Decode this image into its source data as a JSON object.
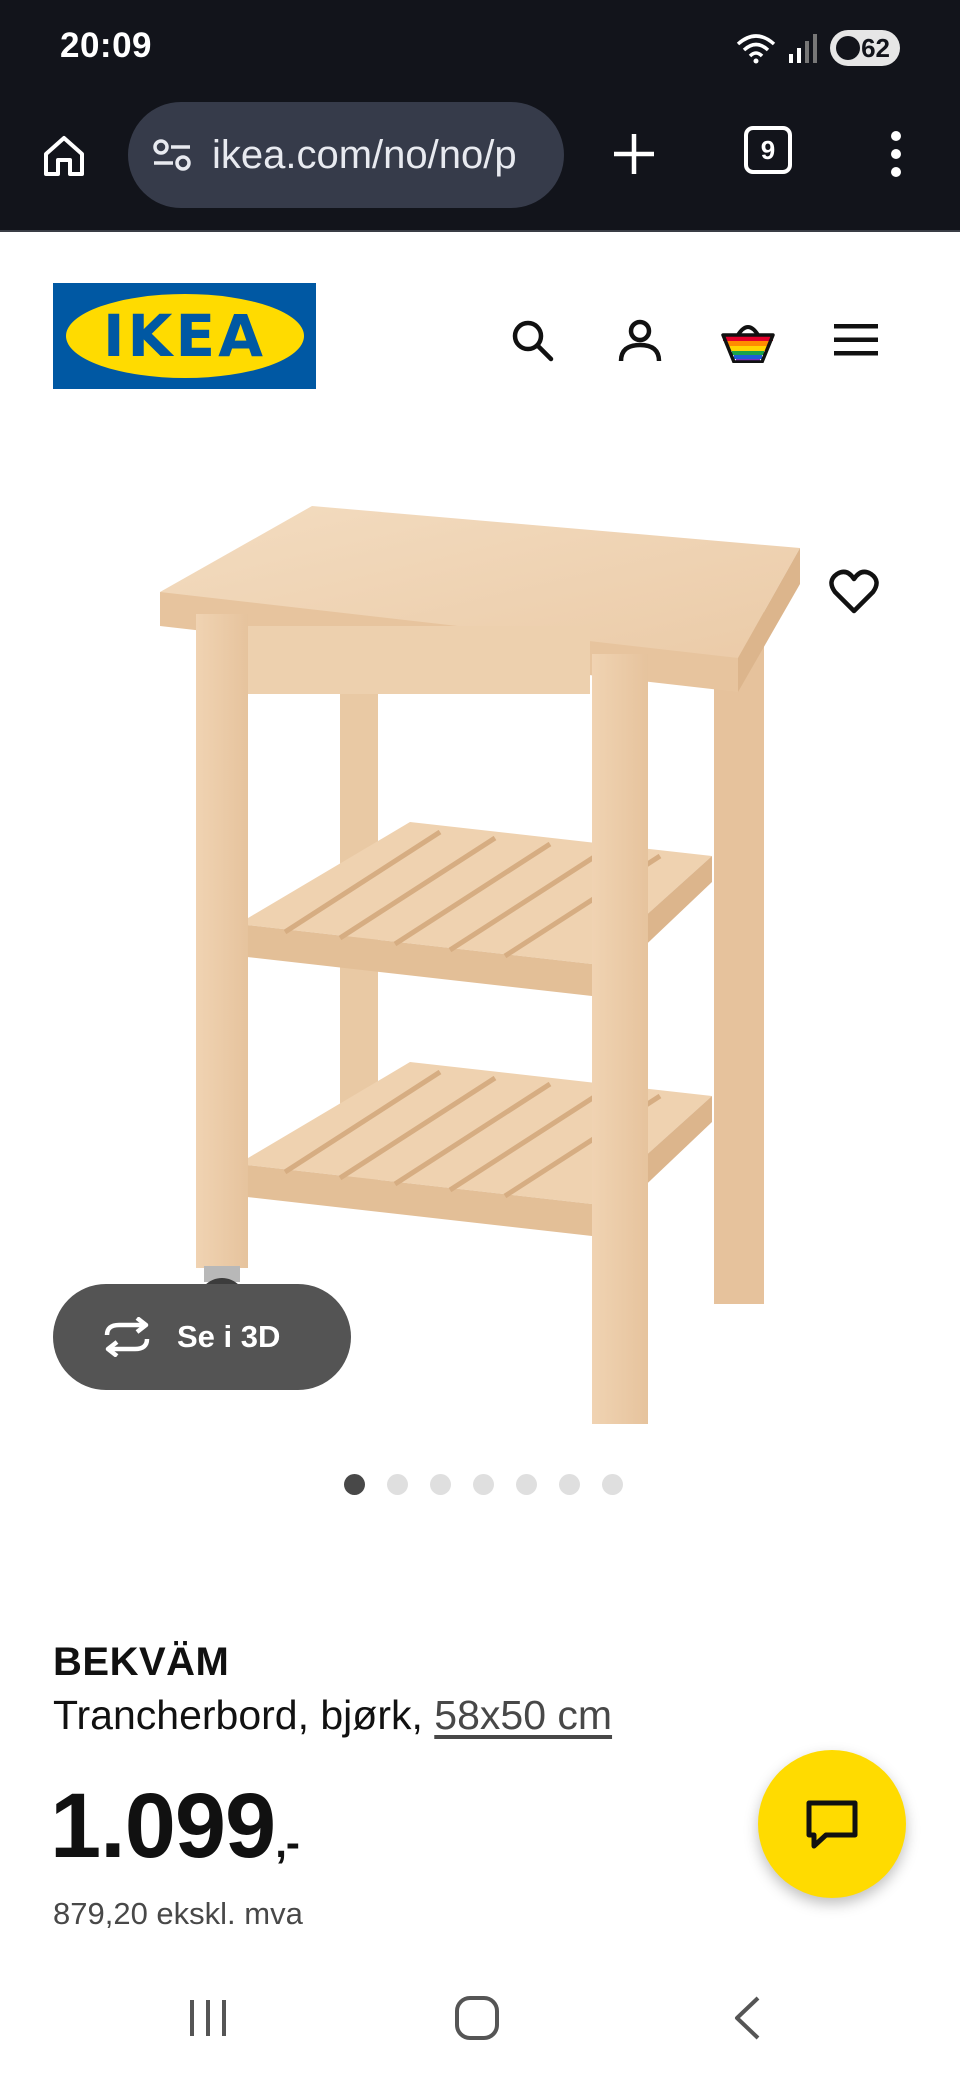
{
  "status_bar": {
    "time": "20:09",
    "battery": "62",
    "icons": [
      "wifi-icon",
      "signal-icon",
      "battery-icon"
    ]
  },
  "browser": {
    "url": "ikea.com/no/no/p",
    "tab_count": "9",
    "icons": [
      "home-icon",
      "site-settings-icon",
      "plus-icon",
      "tabs-icon",
      "more-vertical-icon"
    ]
  },
  "site_header": {
    "logo_text": "IKEA",
    "icons": [
      "search-icon",
      "user-icon",
      "basket-icon",
      "hamburger-menu-icon"
    ]
  },
  "gallery": {
    "see_3d_label": "Se i 3D",
    "dot_count": 7,
    "active_dot": 0
  },
  "product": {
    "name": "BEKVÄM",
    "description": "Trancherbord, bjørk, ",
    "size_link": "58x50 cm",
    "price": "1.099",
    "price_suffix": ",-",
    "price_ex_vat": "879,20 ekskl. mva"
  },
  "colors": {
    "ikea_blue": "#0058a3",
    "ikea_yellow": "#ffdb00",
    "browser_dark": "#12141b"
  }
}
